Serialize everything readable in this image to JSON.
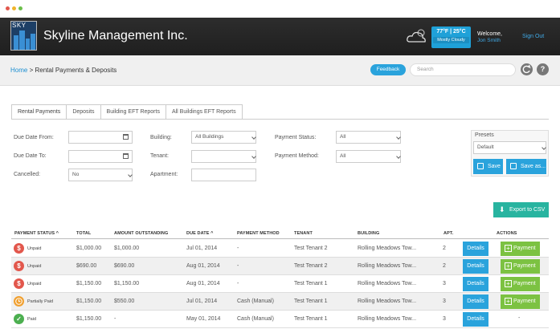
{
  "header": {
    "logo_text": "SKY",
    "brand": "Skyline Management Inc.",
    "weather_temp": "77°F | 25°C",
    "weather_cond": "Mostly Cloudy",
    "welcome": "Welcome,",
    "user_name": "Jon Smith",
    "signout": "Sign Out"
  },
  "breadcrumb": {
    "home": "Home",
    "separator": " > ",
    "current": "Rental Payments & Deposits"
  },
  "toolbar": {
    "feedback": "Feedback",
    "search_placeholder": "Search",
    "refresh_icon": "refresh-icon",
    "help": "?"
  },
  "tabs": [
    "Rental Payments",
    "Deposits",
    "Building EFT Reports",
    "All Buildings EFT Reports"
  ],
  "filters": {
    "due_from_label": "Due Date From:",
    "due_to_label": "Due Date To:",
    "cancelled_label": "Cancelled:",
    "cancelled_value": "No",
    "building_label": "Building:",
    "building_value": "All Buildings",
    "tenant_label": "Tenant:",
    "tenant_value": "",
    "apartment_label": "Apartment:",
    "payment_status_label": "Payment Status:",
    "payment_status_value": "All",
    "payment_method_label": "Payment Method:",
    "payment_method_value": "All"
  },
  "presets": {
    "title": "Presets",
    "selected": "Default",
    "save": "Save",
    "save_as": "Save as..."
  },
  "export": "Export to CSV",
  "table": {
    "headers": {
      "status": "PAYMENT STATUS ^",
      "total": "TOTAL",
      "outstanding": "AMOUNT OUTSTANDING",
      "due": "DUE DATE ^",
      "method": "PAYMENT METHOD",
      "tenant": "TENANT",
      "building": "BUILDING",
      "apt": "APT.",
      "actions": "ACTIONS"
    },
    "rows": [
      {
        "status": "Unpaid",
        "kind": "unpaid",
        "total": "$1,000.00",
        "outstanding": "$1,000.00",
        "due": "Jul 01, 2014",
        "method": "-",
        "tenant": "Test Tenant 2",
        "building": "Rolling Meadows Tow...",
        "apt": "2",
        "details": "Details",
        "payment": "Payment"
      },
      {
        "status": "Unpaid",
        "kind": "unpaid",
        "total": "$690.00",
        "outstanding": "$690.00",
        "due": "Aug 01, 2014",
        "method": "-",
        "tenant": "Test Tenant 2",
        "building": "Rolling Meadows Tow...",
        "apt": "2",
        "details": "Details",
        "payment": "Payment"
      },
      {
        "status": "Unpaid",
        "kind": "unpaid",
        "total": "$1,150.00",
        "outstanding": "$1,150.00",
        "due": "Aug 01, 2014",
        "method": "-",
        "tenant": "Test Tenant 1",
        "building": "Rolling Meadows Tow...",
        "apt": "3",
        "details": "Details",
        "payment": "Payment"
      },
      {
        "status": "Partially Paid",
        "kind": "partial",
        "total": "$1,150.00",
        "outstanding": "$550.00",
        "due": "Jul 01, 2014",
        "method": "Cash (Manual)",
        "tenant": "Test Tenant 1",
        "building": "Rolling Meadows Tow...",
        "apt": "3",
        "details": "Details",
        "payment": "Payment"
      },
      {
        "status": "Paid",
        "kind": "paid",
        "total": "$1,150.00",
        "outstanding": "-",
        "due": "May 01, 2014",
        "method": "Cash (Manual)",
        "tenant": "Test Tenant 1",
        "building": "Rolling Meadows Tow...",
        "apt": "3",
        "details": "Details",
        "payment": "-"
      }
    ]
  },
  "colors": {
    "accent": "#2aa3dc",
    "success": "#7cc242",
    "unpaid": "#e2574c",
    "partial": "#f0a030",
    "paid": "#4caf50",
    "export": "#28b4a0"
  }
}
